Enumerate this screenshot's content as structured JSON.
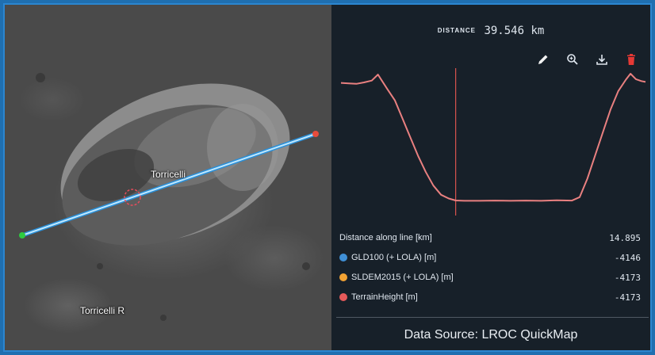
{
  "map": {
    "labels": {
      "crater": "Torricelli",
      "crater_r": "Torricelli R"
    }
  },
  "profile": {
    "distance_key": "DISTANCE",
    "distance_value": "39.546 km",
    "toolbar": {
      "icons": [
        "pencil-icon",
        "zoom-in-icon",
        "download-icon",
        "trash-icon"
      ],
      "delete_color": "#e53935"
    },
    "readout": {
      "distance_label": "Distance along line [km]",
      "distance_value": "14.895",
      "series": [
        {
          "label": "GLD100 (+ LOLA) [m]",
          "value": "-4146",
          "color": "#3f8fd6"
        },
        {
          "label": "SLDEM2015 (+ LOLA) [m]",
          "value": "-4173",
          "color": "#f2a233"
        },
        {
          "label": "TerrainHeight [m]",
          "value": "-4173",
          "color": "#e65a5a"
        }
      ]
    },
    "source": "Data Source: LROC QuickMap"
  },
  "chart_data": {
    "type": "line",
    "x": [
      0,
      1,
      2,
      3,
      4,
      4.8,
      6,
      7,
      8,
      9,
      10,
      11,
      12,
      13,
      14,
      14.9,
      16,
      18,
      20,
      22,
      24,
      26,
      28,
      30,
      31,
      32,
      33,
      34,
      35,
      36,
      37,
      37.6,
      38.3,
      39,
      39.546
    ],
    "y": [
      -1620,
      -1630,
      -1640,
      -1610,
      -1570,
      -1440,
      -1750,
      -2000,
      -2400,
      -2800,
      -3200,
      -3550,
      -3850,
      -4050,
      -4130,
      -4173,
      -4180,
      -4180,
      -4175,
      -4180,
      -4175,
      -4180,
      -4170,
      -4175,
      -4100,
      -3700,
      -3200,
      -2700,
      -2200,
      -1800,
      -1550,
      -1420,
      -1540,
      -1580,
      -1600
    ],
    "cursor_x": 14.895,
    "line_color": "#e98080",
    "cursor_color": "#d9534f",
    "xlim": [
      0,
      39.546
    ],
    "ylim": [
      -4500,
      -1300
    ],
    "grid": false,
    "legend": false
  }
}
